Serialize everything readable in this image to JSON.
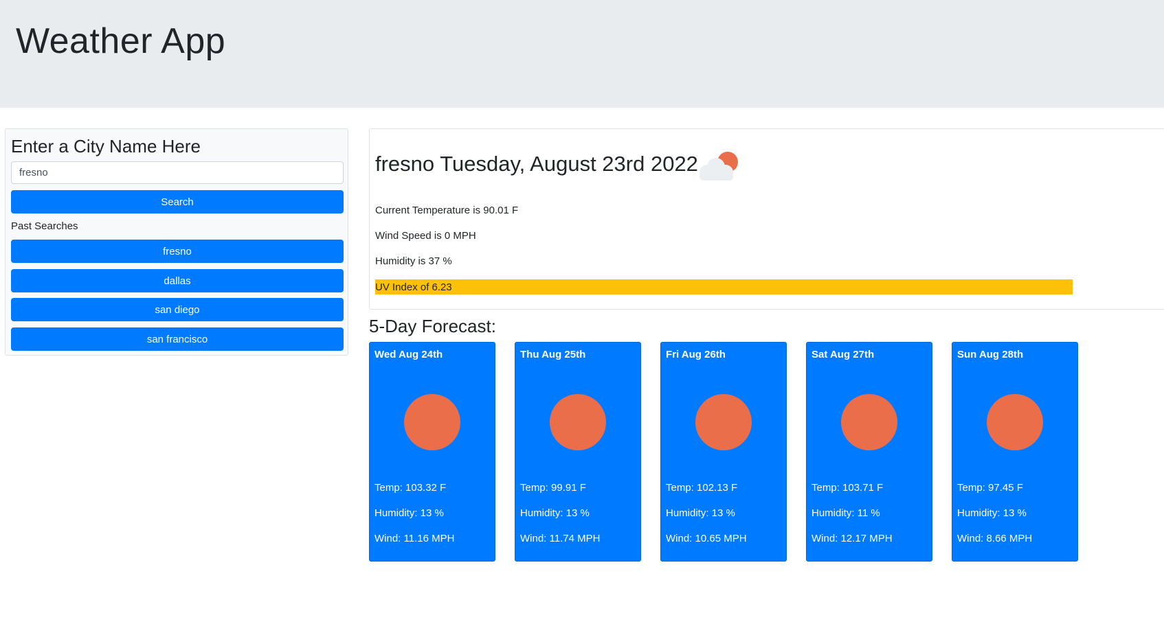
{
  "header": {
    "title": "Weather App"
  },
  "search": {
    "heading": "Enter a City Name Here",
    "input_value": "fresno",
    "button_label": "Search",
    "past_label": "Past Searches",
    "past": [
      "fresno",
      "dallas",
      "san diego",
      "san francisco"
    ]
  },
  "current": {
    "heading": "fresno Tuesday, August 23rd 2022",
    "icon": "partly-cloudy-icon",
    "temperature": "Current Temperature is 90.01 F",
    "wind": "Wind Speed is 0 MPH",
    "humidity": "Humidity is 37 %",
    "uv": "UV Index of 6.23"
  },
  "forecast": {
    "heading": "5-Day Forecast:",
    "days": [
      {
        "date": "Wed Aug 24th",
        "icon": "sun-icon",
        "temp": "Temp: 103.32 F",
        "humidity": "Humidity: 13 %",
        "wind": "Wind: 11.16 MPH"
      },
      {
        "date": "Thu Aug 25th",
        "icon": "sun-icon",
        "temp": "Temp: 99.91 F",
        "humidity": "Humidity: 13 %",
        "wind": "Wind: 11.74 MPH"
      },
      {
        "date": "Fri Aug 26th",
        "icon": "sun-icon",
        "temp": "Temp: 102.13 F",
        "humidity": "Humidity: 13 %",
        "wind": "Wind: 10.65 MPH"
      },
      {
        "date": "Sat Aug 27th",
        "icon": "sun-icon",
        "temp": "Temp: 103.71 F",
        "humidity": "Humidity: 11 %",
        "wind": "Wind: 12.17 MPH"
      },
      {
        "date": "Sun Aug 28th",
        "icon": "sun-icon",
        "temp": "Temp: 97.45 F",
        "humidity": "Humidity: 13 %",
        "wind": "Wind: 8.66 MPH"
      }
    ]
  },
  "colors": {
    "primary": "#007bff",
    "uv_warning": "#ffc107",
    "sun": "#eb6e4b",
    "jumbotron": "#e9ecef"
  }
}
